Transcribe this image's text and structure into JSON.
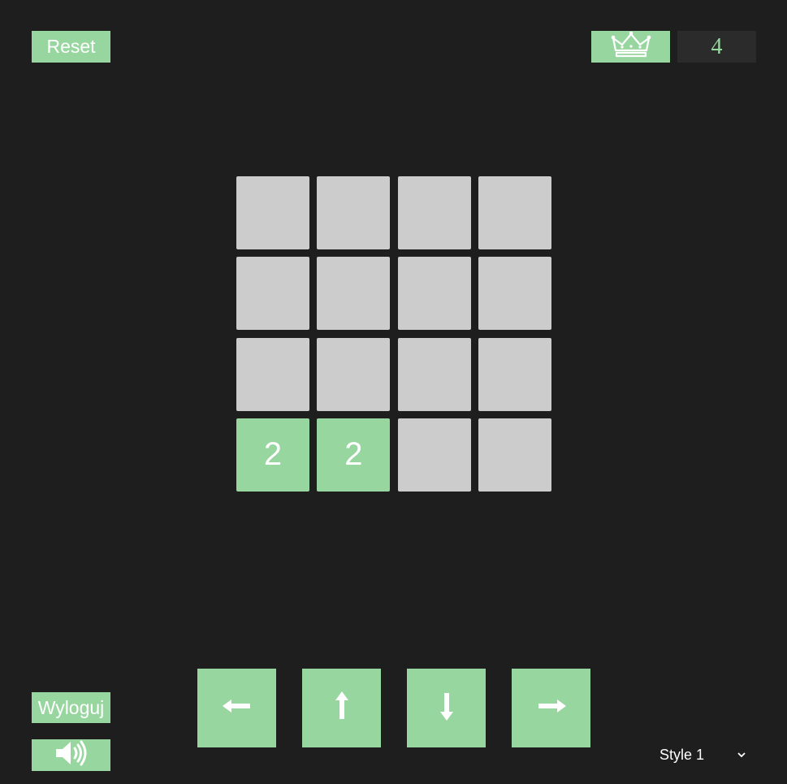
{
  "header": {
    "reset_label": "Reset",
    "crown_icon": "crown-icon",
    "best_score": "4"
  },
  "board": {
    "rows": [
      [
        "",
        "",
        "",
        ""
      ],
      [
        "",
        "",
        "",
        ""
      ],
      [
        "",
        "",
        "",
        ""
      ],
      [
        "2",
        "2",
        "",
        ""
      ]
    ]
  },
  "controls": {
    "logout_label": "Wyloguj",
    "sound_icon": "speaker-icon",
    "arrows": [
      "arrow-left-icon",
      "arrow-up-icon",
      "arrow-down-icon",
      "arrow-right-icon"
    ],
    "style_value": "Style 1"
  },
  "colors": {
    "background": "#1e1e1e",
    "accent": "#98d69f",
    "empty_tile": "#cccccc",
    "score_bg": "#2b2b2b"
  }
}
